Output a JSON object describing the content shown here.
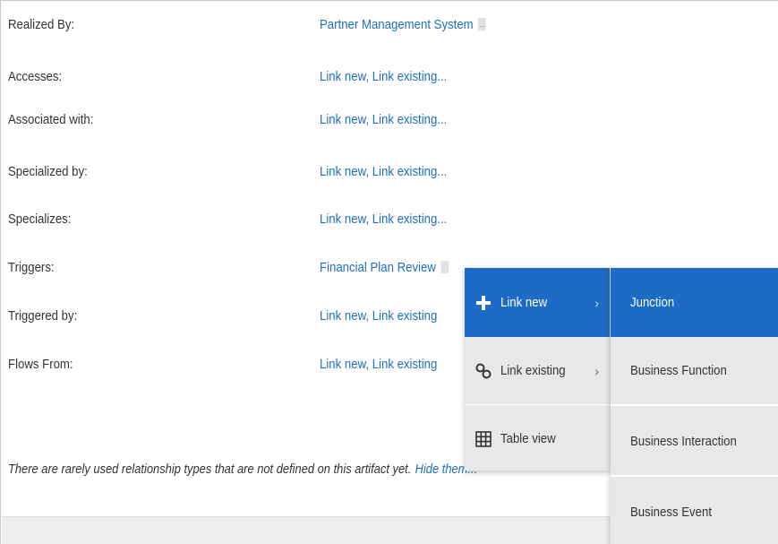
{
  "relationships": [
    {
      "label": "Realized By:",
      "value": "Partner Management System",
      "has_more": true,
      "more_glyph": "..."
    },
    {
      "label": "Accesses:",
      "value": "Link new, Link existing..."
    },
    {
      "label": "Associated with:",
      "value": "Link new, Link existing..."
    },
    {
      "label": "Specialized by:",
      "value": "Link new, Link existing..."
    },
    {
      "label": "Specializes:",
      "value": "Link new, Link existing..."
    },
    {
      "label": "Triggers:",
      "value": "Financial Plan Review",
      "has_more": true,
      "more_glyph": ""
    },
    {
      "label": "Triggered by:",
      "value": "Link new, Link existing"
    },
    {
      "label": "Flows From:",
      "value": "Link new, Link existing"
    }
  ],
  "footer": {
    "note": "There are rarely used relationship types that are not defined on this artifact yet.",
    "hide_link": "Hide them..."
  },
  "context_menu": {
    "items": [
      {
        "label": "Link new",
        "icon": "plus-icon",
        "arrow": "›"
      },
      {
        "label": "Link existing",
        "icon": "chain-link-icon",
        "arrow": "›"
      },
      {
        "label": "Table view",
        "icon": "table-grid-icon"
      }
    ]
  },
  "submenu": {
    "items": [
      {
        "label": "Junction"
      },
      {
        "label": "Business Function"
      },
      {
        "label": "Business Interaction"
      },
      {
        "label": "Business Event"
      }
    ]
  },
  "colors": {
    "link": "#1f6fbf",
    "menu_highlight": "#1d6bc6",
    "menu_bg": "#e8e8e8"
  }
}
